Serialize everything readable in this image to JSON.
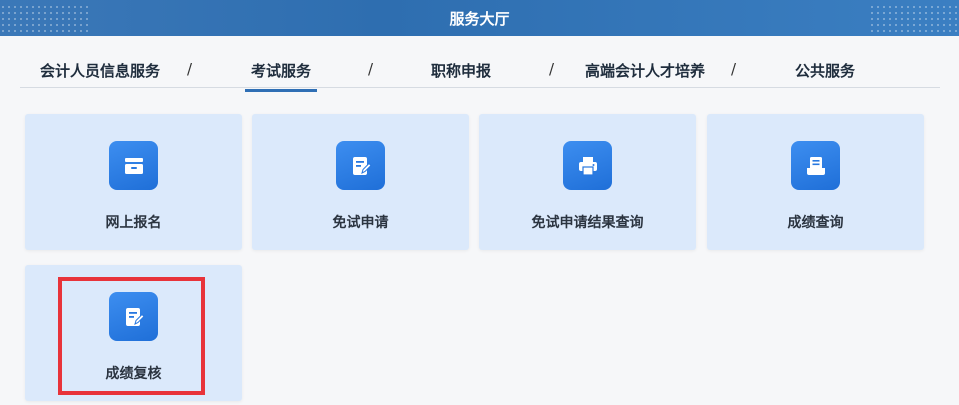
{
  "header": {
    "title": "服务大厅"
  },
  "tabs": [
    {
      "label": "会计人员信息服务"
    },
    {
      "label": "考试服务"
    },
    {
      "label": "职称申报"
    },
    {
      "label": "高端会计人才培养"
    },
    {
      "label": "公共服务"
    }
  ],
  "separator": "/",
  "active_tab": "考试服务",
  "cards": [
    {
      "label": "网上报名",
      "icon": "drawer-icon"
    },
    {
      "label": "免试申请",
      "icon": "edit-document-icon"
    },
    {
      "label": "免试申请结果查询",
      "icon": "printer-icon"
    },
    {
      "label": "成绩查询",
      "icon": "document-tray-icon"
    },
    {
      "label": "成绩复核",
      "icon": "edit-document-icon"
    }
  ],
  "colors": {
    "header_bg": "#2e6eb0",
    "card_bg": "#dbe9fb",
    "icon_bg": "#2878e0",
    "highlight": "#e8333a"
  }
}
